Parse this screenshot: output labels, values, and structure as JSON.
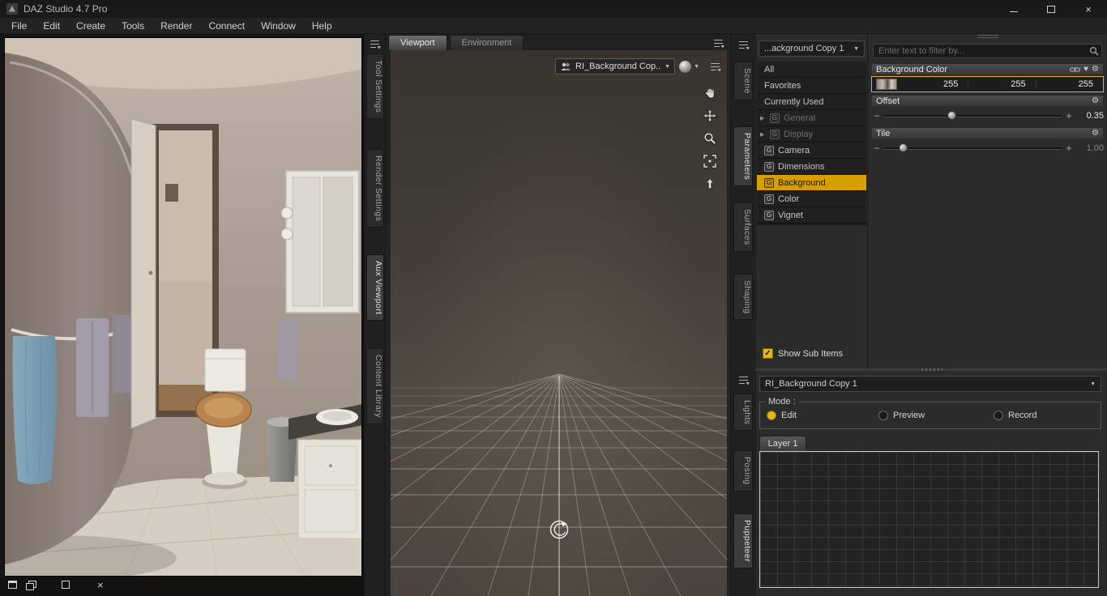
{
  "window": {
    "title": "DAZ Studio 4.7 Pro"
  },
  "menu": {
    "items": [
      "File",
      "Edit",
      "Create",
      "Tools",
      "Render",
      "Connect",
      "Window",
      "Help"
    ]
  },
  "left_tabs": {
    "items": [
      "Tool Settings",
      "Render Settings",
      "Aux Viewport",
      "Content Library"
    ]
  },
  "viewport": {
    "tabs": [
      "Viewport",
      "Environment"
    ],
    "camera_selector": "RI_Background Cop..."
  },
  "right_tabs": {
    "upper": [
      "Scene",
      "Parameters",
      "Surfaces",
      "Shaping"
    ],
    "lower": [
      "Lights",
      "Posing",
      "Puppeteer"
    ]
  },
  "parameters_pane": {
    "group_selector": "...ackground Copy 1",
    "items": [
      {
        "label": "All"
      },
      {
        "label": "Favorites"
      },
      {
        "label": "Currently Used"
      },
      {
        "label": "General"
      },
      {
        "label": "Display"
      },
      {
        "label": "Camera"
      },
      {
        "label": "Dimensions"
      },
      {
        "label": "Background"
      },
      {
        "label": "Color"
      },
      {
        "label": "Vignet"
      }
    ],
    "show_sub_items_label": "Show Sub Items"
  },
  "properties_pane": {
    "filter_placeholder": "Enter text to filter by...",
    "background_color": {
      "label": "Background Color",
      "r": "255",
      "g": "255",
      "b": "255"
    },
    "offset": {
      "label": "Offset",
      "value": "0.35"
    },
    "tile": {
      "label": "Tile",
      "value": "1.00"
    }
  },
  "puppeteer_pane": {
    "selector": "RI_Background Copy 1",
    "mode_label": "Mode :",
    "modes": [
      "Edit",
      "Preview",
      "Record"
    ],
    "layer_tab": "Layer 1"
  },
  "icons": {
    "dropdown_arrow": "▼",
    "expand_arrow": "▶",
    "check": "✓",
    "close": "×",
    "minus": "−",
    "plus": "+",
    "heart": "♥",
    "gear": "⚙",
    "group_letter": "G"
  },
  "colors": {
    "accent": "#e8b417",
    "selection": "#d79e00",
    "viewport_bg": "#4b443c"
  }
}
